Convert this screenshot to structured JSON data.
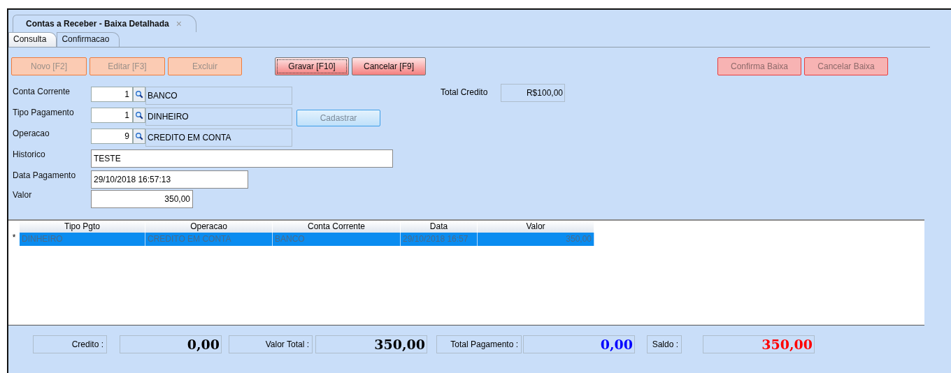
{
  "window": {
    "title": "Contas a Receber - Baixa Detalhada",
    "close": "×"
  },
  "tabs": [
    {
      "label": "Consulta",
      "selected": false
    },
    {
      "label": "Confirmacao",
      "selected": true
    }
  ],
  "toolbar": {
    "left": [
      {
        "label": "Novo [F2]",
        "kind": "orange",
        "focused": false
      },
      {
        "label": "Editar [F3]",
        "kind": "orange",
        "focused": false
      },
      {
        "label": "Excluir",
        "kind": "orange",
        "focused": false
      }
    ],
    "center": [
      {
        "label": "Gravar [F10]",
        "kind": "red",
        "focused": true
      },
      {
        "label": "Cancelar [F9]",
        "kind": "red",
        "focused": false
      }
    ],
    "right": [
      {
        "label": "Confirma Baixa",
        "kind": "pink",
        "focused": false
      },
      {
        "label": "Cancelar Baixa",
        "kind": "pink",
        "focused": false
      }
    ]
  },
  "form": {
    "lookups": [
      {
        "label": "Conta Corrente",
        "code": "1",
        "description": "BANCO"
      },
      {
        "label": "Tipo Pagamento",
        "code": "1",
        "description": "DINHEIRO"
      },
      {
        "label": "Operacao",
        "code": "9",
        "description": "CREDITO EM CONTA"
      }
    ],
    "cadastrar": "Cadastrar",
    "total_credito": {
      "label": "Total Credito",
      "value": "R$100,00"
    },
    "historico": {
      "label": "Historico",
      "value": "TESTE"
    },
    "data_pagamento": {
      "label": "Data Pagamento",
      "value": "29/10/2018 16:57:13"
    },
    "valor": {
      "label": "Valor",
      "value": "350,00"
    }
  },
  "table": {
    "columns": [
      "Tipo Pgto",
      "Operacao",
      "Conta Corrente",
      "Data",
      "Valor"
    ],
    "rows": [
      {
        "marker": "*",
        "selected": true,
        "cells": [
          "DINHEIRO",
          "CREDITO EM CONTA",
          "BANCO",
          "29/10/2018 16:57",
          "350,00"
        ]
      }
    ]
  },
  "totals": [
    {
      "label": "Credito :",
      "value": "0,00",
      "color": "#000000"
    },
    {
      "label": "Valor Total  :",
      "value": "350,00",
      "color": "#000000"
    },
    {
      "label": "Total Pagamento :",
      "value": "0,00",
      "color": "#0000ff"
    },
    {
      "label": "Saldo :",
      "value": "350,00",
      "color": "#ff0000"
    }
  ]
}
